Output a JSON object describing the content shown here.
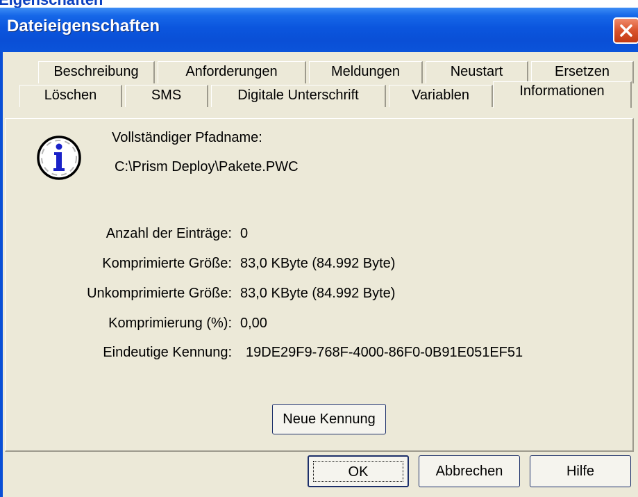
{
  "background": {
    "partial_title": "Eigenschaften"
  },
  "dialog": {
    "title": "Dateieigenschaften",
    "close_icon": "close-x-icon"
  },
  "tabs": {
    "row1": [
      "Beschreibung",
      "Anforderungen",
      "Meldungen",
      "Neustart",
      "Ersetzen"
    ],
    "row2": [
      "Löschen",
      "SMS",
      "Digitale Unterschrift",
      "Variablen",
      "Informationen"
    ],
    "active": "Informationen"
  },
  "info": {
    "icon": "info-icon",
    "path_label": "Vollständiger Pfadname:",
    "path_value": "C:\\Prism Deploy\\Pakete.PWC",
    "fields": [
      {
        "label": "Anzahl der Einträge:",
        "value": "0"
      },
      {
        "label": "Komprimierte Größe:",
        "value": "83,0 KByte (84.992 Byte)"
      },
      {
        "label": "Unkomprimierte Größe:",
        "value": "83,0 KByte (84.992 Byte)"
      },
      {
        "label": "Komprimierung (%):",
        "value": "0,00"
      },
      {
        "label": "Eindeutige Kennung:",
        "value": "19DE29F9-768F-4000-86F0-0B91E051EF51"
      }
    ],
    "new_id_button": "Neue Kennung"
  },
  "buttons": {
    "ok": "OK",
    "cancel": "Abbrechen",
    "help": "Hilfe"
  },
  "colors": {
    "titlebar": "#0a4fd6",
    "dialog_face": "#ece9d8",
    "close_button": "#d9532c"
  }
}
